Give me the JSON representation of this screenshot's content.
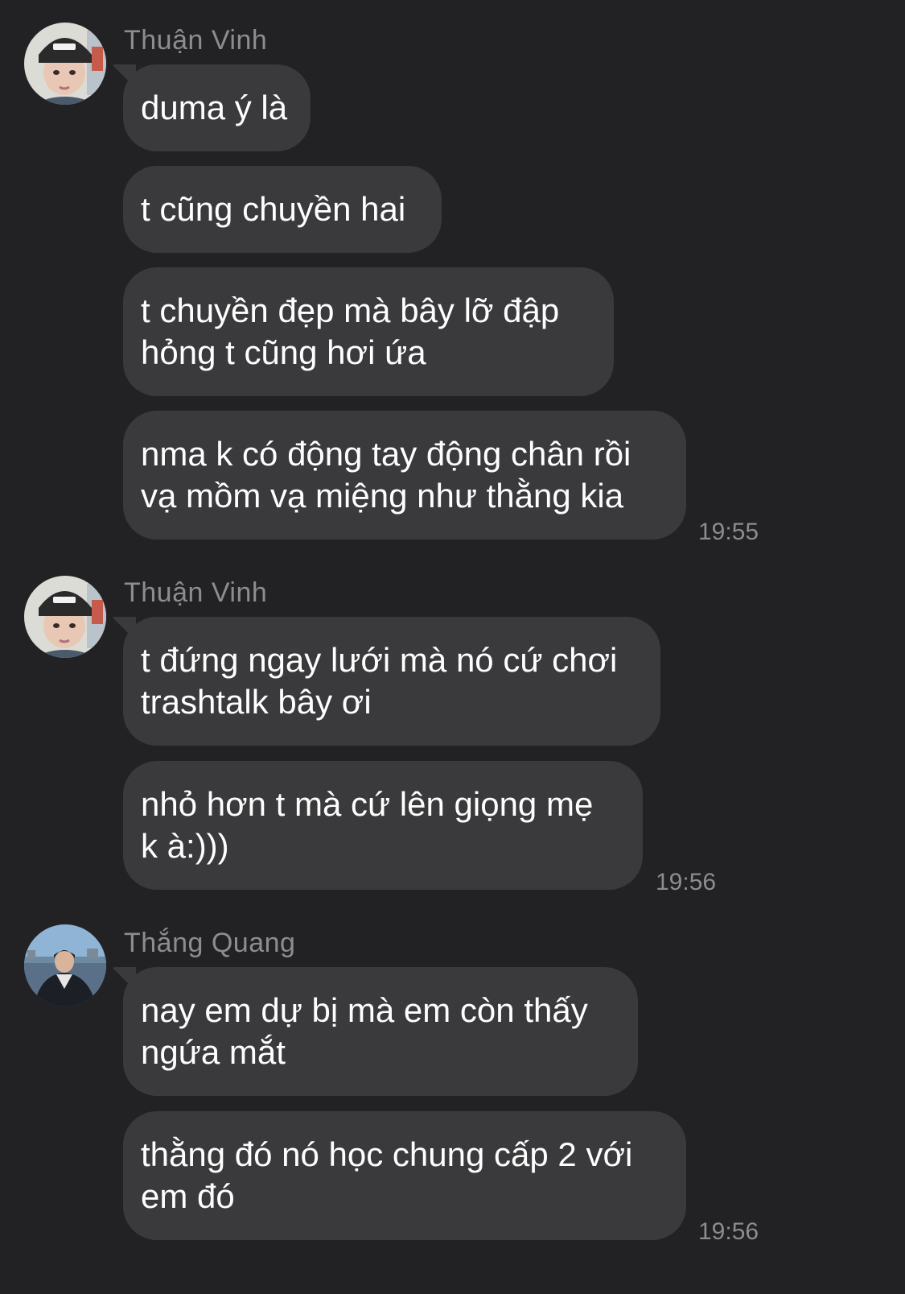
{
  "colors": {
    "background": "#222224",
    "bubble": "#3a3a3c",
    "text": "#ffffff",
    "meta": "#8c8c91"
  },
  "groups": [
    {
      "sender": "Thuận Vinh",
      "avatar_icon": "avatar-thuan-vinh",
      "messages": [
        "duma ý là",
        "t cũng chuyền hai",
        "t chuyền đẹp mà bây lỡ đập\nhỏng t cũng hơi ứa",
        "nma k có động tay động chân rồi\nvạ mồm vạ miệng như thằng kia"
      ],
      "time": "19:55"
    },
    {
      "sender": "Thuận Vinh",
      "avatar_icon": "avatar-thuan-vinh",
      "messages": [
        "t đứng ngay lưới mà nó cứ chơi\ntrashtalk bây ơi",
        "nhỏ hơn t mà cứ lên giọng mẹ\nk à:)))"
      ],
      "time": "19:56"
    },
    {
      "sender": "Thắng Quang",
      "avatar_icon": "avatar-thang-quang",
      "messages": [
        "nay em dự bị mà em còn thấy\nngứa mắt",
        "thằng đó nó học chung cấp 2 với\nem đó"
      ],
      "time": "19:56"
    }
  ]
}
